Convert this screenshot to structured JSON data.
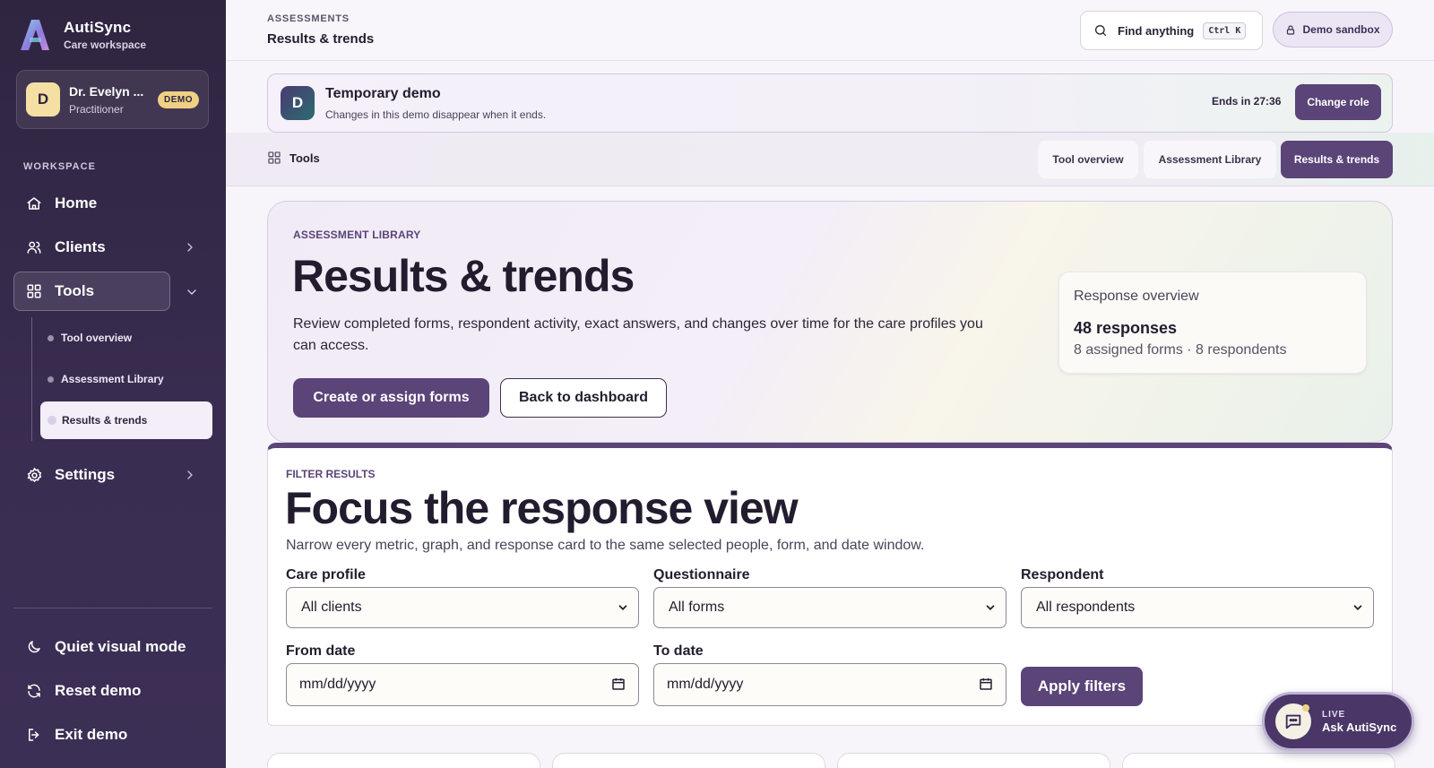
{
  "brand": {
    "name": "AutiSync",
    "subtitle": "Care workspace"
  },
  "profile": {
    "initial": "D",
    "name": "Dr. Evelyn ...",
    "role": "Practitioner",
    "badge": "DEMO"
  },
  "sidebar": {
    "section_label": "WORKSPACE",
    "items": [
      {
        "label": "Home",
        "icon": "home-icon"
      },
      {
        "label": "Clients",
        "icon": "users-icon",
        "has_chevron": true
      },
      {
        "label": "Tools",
        "icon": "grid-icon",
        "expanded": true
      },
      {
        "label": "Settings",
        "icon": "gear-icon",
        "has_chevron": true
      }
    ],
    "tools_subitems": [
      {
        "label": "Tool overview"
      },
      {
        "label": "Assessment Library"
      },
      {
        "label": "Results & trends",
        "active": true
      }
    ],
    "footer_items": [
      {
        "label": "Quiet visual mode",
        "icon": "moon-icon"
      },
      {
        "label": "Reset demo",
        "icon": "refresh-icon"
      },
      {
        "label": "Exit demo",
        "icon": "logout-icon"
      }
    ]
  },
  "topbar": {
    "breadcrumb_section": "ASSESSMENTS",
    "breadcrumb_title": "Results & trends",
    "search_label": "Find anything",
    "search_shortcut": "Ctrl K",
    "sandbox_label": "Demo sandbox"
  },
  "demo_banner": {
    "initial": "D",
    "title": "Temporary demo",
    "description": "Changes in this demo disappear when it ends.",
    "ends_in": "Ends in 27:36",
    "change_role": "Change role"
  },
  "tools_bar": {
    "label": "Tools",
    "tabs": [
      {
        "label": "Tool overview"
      },
      {
        "label": "Assessment Library"
      },
      {
        "label": "Results & trends",
        "active": true
      }
    ]
  },
  "hero": {
    "eyebrow": "ASSESSMENT LIBRARY",
    "title": "Results & trends",
    "description": "Review completed forms, respondent activity, exact answers, and changes over time for the care profiles you can access.",
    "primary_button": "Create or assign forms",
    "secondary_button": "Back to dashboard",
    "overview": {
      "label": "Response overview",
      "value": "48 responses",
      "sub": "8 assigned forms · 8 respondents"
    }
  },
  "filters": {
    "eyebrow": "FILTER RESULTS",
    "title": "Focus the response view",
    "description": "Narrow every metric, graph, and response card to the same selected people, form, and date window.",
    "care_profile": {
      "label": "Care profile",
      "value": "All clients"
    },
    "questionnaire": {
      "label": "Questionnaire",
      "value": "All forms"
    },
    "respondent": {
      "label": "Respondent",
      "value": "All respondents"
    },
    "from_date": {
      "label": "From date",
      "placeholder": "mm/dd/yyyy"
    },
    "to_date": {
      "label": "To date",
      "placeholder": "mm/dd/yyyy"
    },
    "apply": "Apply filters"
  },
  "live_chat": {
    "tag": "LIVE",
    "label": "Ask AutiSync"
  },
  "colors": {
    "sidebar": "#2f2540",
    "accent": "#5a4478",
    "badge": "#f0d184"
  }
}
